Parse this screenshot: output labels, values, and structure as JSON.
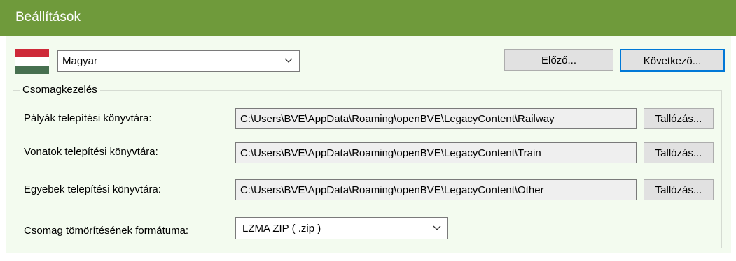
{
  "header": {
    "title": "Beállítások"
  },
  "language": {
    "flag_icon": "hungary-flag-icon",
    "flag_colors": [
      "#ce2939",
      "#ffffff",
      "#477050"
    ],
    "selected": "Magyar"
  },
  "nav": {
    "prev_label": "Előző...",
    "next_label": "Következő..."
  },
  "package_group": {
    "title": "Csomagkezelés",
    "routes_label": "Pályák telepítési könyvtára:",
    "routes_path": "C:\\Users\\BVE\\AppData\\Roaming\\openBVE\\LegacyContent\\Railway",
    "trains_label": "Vonatok telepítési könyvtára:",
    "trains_path": "C:\\Users\\BVE\\AppData\\Roaming\\openBVE\\LegacyContent\\Train",
    "other_label": "Egyebek telepítési könyvtára:",
    "other_path": "C:\\Users\\BVE\\AppData\\Roaming\\openBVE\\LegacyContent\\Other",
    "browse_label": "Tallózás...",
    "compression_label": "Csomag tömörítésének formátuma:",
    "compression_value": "LZMA ZIP ( .zip )"
  },
  "colors": {
    "header": "#6f9a3b",
    "panel": "#f3fbef",
    "focus": "#0078d7"
  }
}
